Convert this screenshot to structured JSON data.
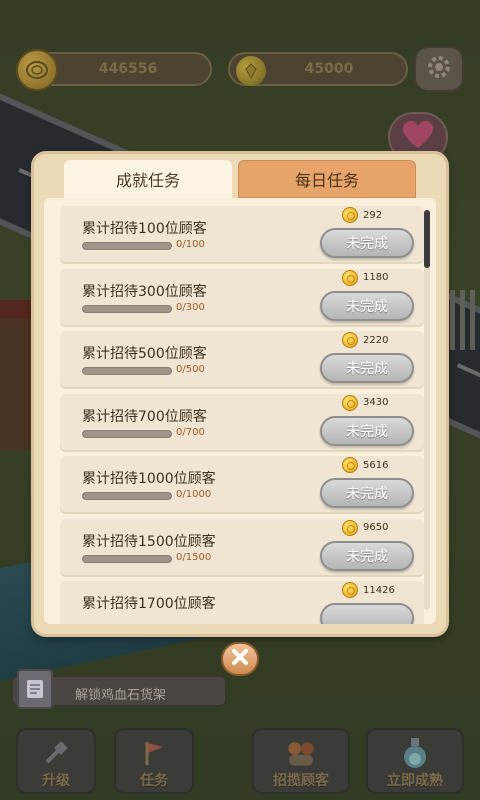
{
  "hud": {
    "gold": "446556",
    "gems": "45000"
  },
  "tabs": {
    "achievement": "成就任务",
    "daily": "每日任务"
  },
  "tasks": [
    {
      "title": "累计招待100位顾客",
      "progress": "0/100",
      "reward": "292",
      "status": "未完成"
    },
    {
      "title": "累计招待300位顾客",
      "progress": "0/300",
      "reward": "1180",
      "status": "未完成"
    },
    {
      "title": "累计招待500位顾客",
      "progress": "0/500",
      "reward": "2220",
      "status": "未完成"
    },
    {
      "title": "累计招待700位顾客",
      "progress": "0/700",
      "reward": "3430",
      "status": "未完成"
    },
    {
      "title": "累计招待1000位顾客",
      "progress": "0/1000",
      "reward": "5616",
      "status": "未完成"
    },
    {
      "title": "累计招待1500位顾客",
      "progress": "0/1500",
      "reward": "9650",
      "status": "未完成"
    },
    {
      "title": "累计招待1700位顾客",
      "progress": "",
      "reward": "11426",
      "status": ""
    }
  ],
  "quest_bar": {
    "text": "解锁鸡血石货架"
  },
  "bottom": {
    "upgrade": "升级",
    "task": "任务",
    "attract": "招揽顾客",
    "instant": "立即成熟"
  },
  "colors": {
    "panel": "#ecd9b6",
    "tab_active": "#fbf4e3",
    "tab_inactive": "#e6a46b",
    "progress_text": "#a05a28"
  }
}
